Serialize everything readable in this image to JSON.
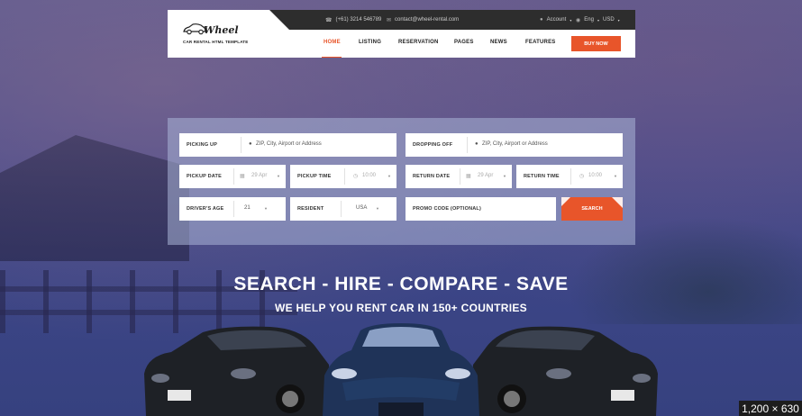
{
  "header": {
    "logo": {
      "name": "Wheel",
      "tagline": "CAR RENTAL HTML TEMPLATE"
    },
    "topbar": {
      "phone": "(+61) 3214 546789",
      "email": "contact@wheel-rental.com",
      "account": "Account",
      "language": "Eng",
      "currency": "USD"
    },
    "nav": [
      {
        "label": "HOME",
        "active": true
      },
      {
        "label": "LISTING"
      },
      {
        "label": "RESERVATION"
      },
      {
        "label": "PAGES"
      },
      {
        "label": "NEWS"
      },
      {
        "label": "FEATURES"
      }
    ],
    "buy_now": "BUY NOW"
  },
  "search": {
    "picking_up": {
      "label": "PICKING UP",
      "placeholder": "ZIP, City, Airport or Address"
    },
    "dropping_off": {
      "label": "DROPPING OFF",
      "placeholder": "ZIP, City, Airport or Address"
    },
    "pickup_date": {
      "label": "PICKUP DATE",
      "value": "29 Apr"
    },
    "pickup_time": {
      "label": "PICKUP TIME",
      "value": "10:00"
    },
    "return_date": {
      "label": "RETURN DATE",
      "value": "29 Apr"
    },
    "return_time": {
      "label": "RETURN TIME",
      "value": "10:00"
    },
    "drivers_age": {
      "label": "DRIVER'S AGE",
      "value": "21"
    },
    "resident": {
      "label": "RESIDENT",
      "value": "USA"
    },
    "promo_code": {
      "label": "PROMO CODE (OPTIONAL)"
    },
    "search_button": "SEARCH"
  },
  "hero": {
    "title": "SEARCH - HIRE - COMPARE - SAVE",
    "subtitle": "WE HELP YOU RENT CAR IN 150+ COUNTRIES"
  },
  "image_size_badge": "1,200 × 630",
  "colors": {
    "accent": "#e8552a",
    "topbar": "#2d2d2d",
    "background": "#3a4585"
  }
}
